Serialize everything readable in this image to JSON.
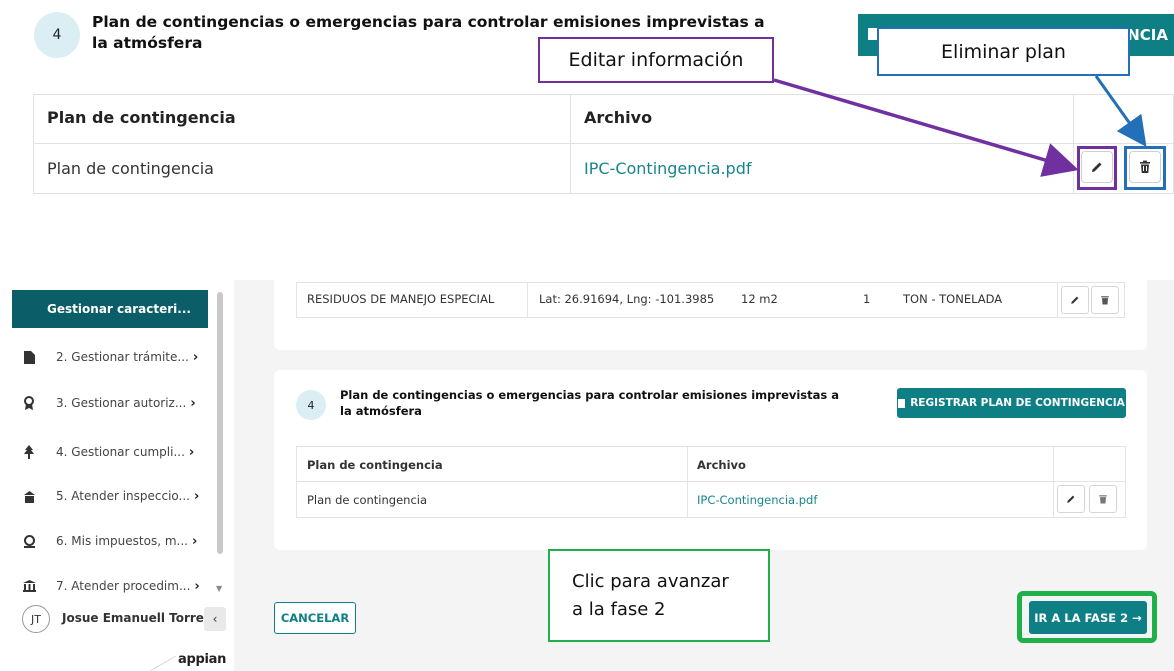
{
  "zoom": {
    "step_number": "4",
    "title": "Plan de contingencias o emergencias para controlar emisiones imprevistas a la atmósfera",
    "register_button_partial": "NCIA",
    "table": {
      "headers": [
        "Plan de contingencia",
        "Archivo"
      ],
      "row": {
        "plan": "Plan de contingencia",
        "file": "IPC-Contingencia.pdf"
      }
    },
    "callouts": {
      "edit": "Editar información",
      "delete": "Eliminar plan"
    },
    "colors": {
      "edit_highlight": "#7030a0",
      "delete_highlight": "#2370b8"
    }
  },
  "sidebar": {
    "active_item": "Gestionar caracteri...",
    "items": [
      {
        "label": "2. Gestionar trámite...",
        "icon": "document-icon"
      },
      {
        "label": "3. Gestionar autoriz...",
        "icon": "award-icon"
      },
      {
        "label": "4. Gestionar cumpli...",
        "icon": "tree-icon"
      },
      {
        "label": "5. Atender inspeccio...",
        "icon": "inspection-icon"
      },
      {
        "label": "6. Mis impuestos, m...",
        "icon": "money-icon"
      },
      {
        "label": "7. Atender procedim...",
        "icon": "institution-icon"
      }
    ],
    "user_initials": "JT",
    "user_name": "Josue Emanuell Torres",
    "brand": "appian"
  },
  "waste_row": {
    "type": "RESIDUOS DE MANEJO ESPECIAL",
    "location": "Lat: 26.91694, Lng: -101.3985",
    "area": "12 m2",
    "quantity": "1",
    "unit": "TON - TONELADA"
  },
  "section4": {
    "step_number": "4",
    "title": "Plan de contingencias o emergencias para controlar emisiones imprevistas a la atmósfera",
    "register_button": "REGISTRAR PLAN DE CONTINGENCIA",
    "headers": [
      "Plan de contingencia",
      "Archivo"
    ],
    "row": {
      "plan": "Plan de contingencia",
      "file": "IPC-Contingencia.pdf"
    }
  },
  "footer": {
    "cancel_label": "CANCELAR",
    "next_label": "IR A LA FASE 2 →",
    "callout": "Clic para avanzar a la fase 2"
  },
  "colors": {
    "teal": "#0f7f86",
    "sidebar_active": "#0b5e68",
    "next_highlight": "#1fb04a"
  }
}
